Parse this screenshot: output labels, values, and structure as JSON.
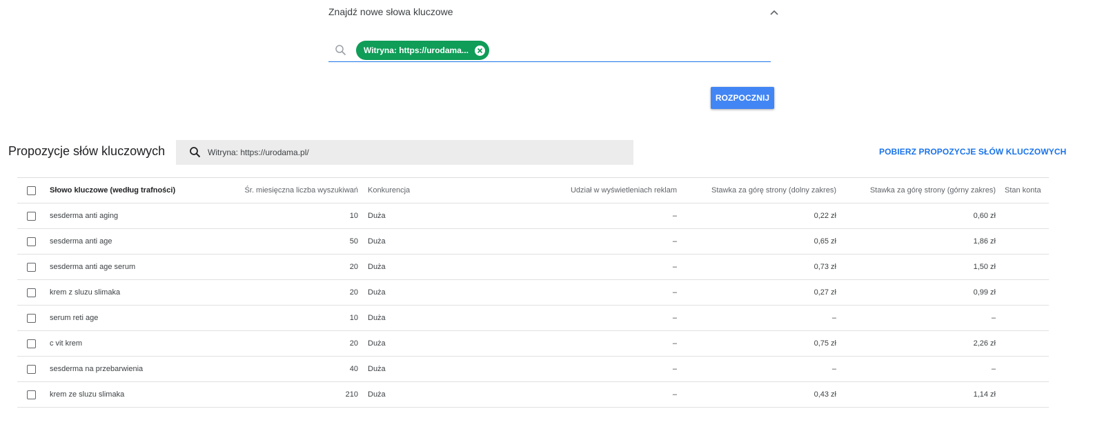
{
  "idea_panel": {
    "title": "Znajdź nowe słowa kluczowe",
    "chip_label": "Witryna: https://urodama...",
    "start_button": "ROZPOCZNIJ"
  },
  "results": {
    "title": "Propozycje słów kluczowych",
    "filter_text": "Witryna: https://urodama.pl/",
    "download_link": "POBIERZ PROPOZYCJE SŁÓW KLUCZOWYCH"
  },
  "table": {
    "columns": {
      "keyword": "Słowo kluczowe (według trafności)",
      "avg_searches": "Śr. miesięczna liczba wyszukiwań",
      "competition": "Konkurencja",
      "impression_share": "Udział w wyświetleniach reklam",
      "bid_low": "Stawka za górę strony (dolny zakres)",
      "bid_high": "Stawka za górę strony (górny zakres)",
      "account_status": "Stan konta"
    },
    "rows": [
      {
        "keyword": "sesderma anti aging",
        "avg_searches": "10",
        "competition": "Duża",
        "impression_share": "–",
        "bid_low": "0,22 zł",
        "bid_high": "0,60 zł"
      },
      {
        "keyword": "sesderma anti age",
        "avg_searches": "50",
        "competition": "Duża",
        "impression_share": "–",
        "bid_low": "0,65 zł",
        "bid_high": "1,86 zł"
      },
      {
        "keyword": "sesderma anti age serum",
        "avg_searches": "20",
        "competition": "Duża",
        "impression_share": "–",
        "bid_low": "0,73 zł",
        "bid_high": "1,50 zł"
      },
      {
        "keyword": "krem z sluzu slimaka",
        "avg_searches": "20",
        "competition": "Duża",
        "impression_share": "–",
        "bid_low": "0,27 zł",
        "bid_high": "0,99 zł"
      },
      {
        "keyword": "serum reti age",
        "avg_searches": "10",
        "competition": "Duża",
        "impression_share": "–",
        "bid_low": "–",
        "bid_high": "–"
      },
      {
        "keyword": "c vit krem",
        "avg_searches": "20",
        "competition": "Duża",
        "impression_share": "–",
        "bid_low": "0,75 zł",
        "bid_high": "2,26 zł"
      },
      {
        "keyword": "sesderma na przebarwienia",
        "avg_searches": "40",
        "competition": "Duża",
        "impression_share": "–",
        "bid_low": "–",
        "bid_high": "–"
      },
      {
        "keyword": "krem ze sluzu slimaka",
        "avg_searches": "210",
        "competition": "Duża",
        "impression_share": "–",
        "bid_low": "0,43 zł",
        "bid_high": "1,14 zł"
      }
    ]
  },
  "colors": {
    "chip": "#0f9d58",
    "primary_button": "#4285f4",
    "link": "#1a73e8",
    "filter_bg": "#ececec"
  },
  "icons": {
    "collapse": "chevron-up-icon",
    "search": "search-icon",
    "chip_remove": "close-circle-icon",
    "row_select": "checkbox-icon"
  }
}
